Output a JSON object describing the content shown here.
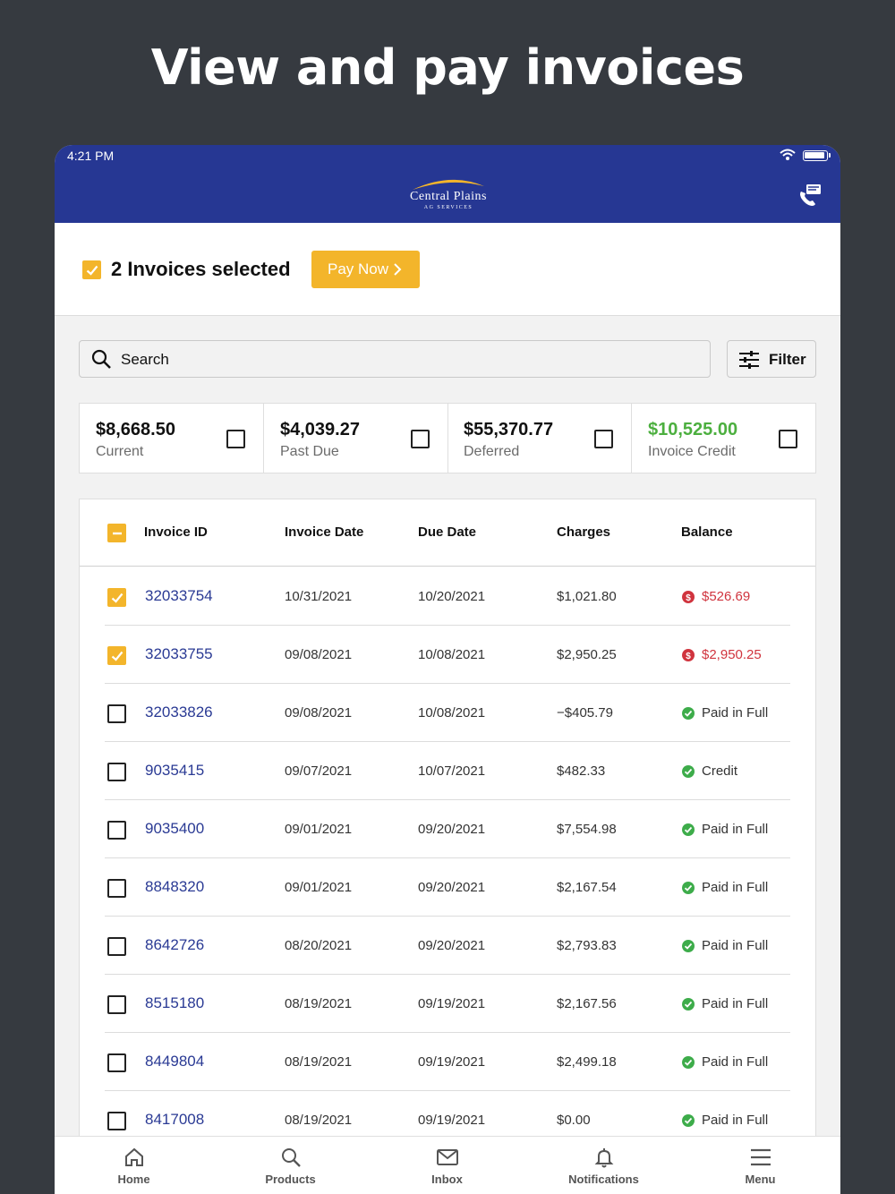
{
  "headline": "View and pay invoices",
  "status": {
    "time": "4:21 PM"
  },
  "brand": {
    "name": "Central Plains",
    "sub": "AG SERVICES"
  },
  "selection": {
    "text": "2 Invoices selected",
    "pay_label": "Pay Now"
  },
  "search": {
    "placeholder": "Search"
  },
  "filter": {
    "label": "Filter"
  },
  "summary": [
    {
      "amount": "$8,668.50",
      "label": "Current"
    },
    {
      "amount": "$4,039.27",
      "label": "Past Due"
    },
    {
      "amount": "$55,370.77",
      "label": "Deferred"
    },
    {
      "amount": "$10,525.00",
      "label": "Invoice Credit"
    }
  ],
  "table": {
    "headers": {
      "id": "Invoice ID",
      "invoice_date": "Invoice Date",
      "due_date": "Due Date",
      "charges": "Charges",
      "balance": "Balance"
    },
    "rows": [
      {
        "id": "32033754",
        "invoice_date": "10/31/2021",
        "due_date": "10/20/2021",
        "charges": "$1,021.80",
        "balance": "$526.69",
        "status": "due",
        "checked": true
      },
      {
        "id": "32033755",
        "invoice_date": "09/08/2021",
        "due_date": "10/08/2021",
        "charges": "$2,950.25",
        "balance": "$2,950.25",
        "status": "due",
        "checked": true
      },
      {
        "id": "32033826",
        "invoice_date": "09/08/2021",
        "due_date": "10/08/2021",
        "charges": "−$405.79",
        "balance": "Paid in Full",
        "status": "paid",
        "checked": false
      },
      {
        "id": "9035415",
        "invoice_date": "09/07/2021",
        "due_date": "10/07/2021",
        "charges": "$482.33",
        "balance": "Credit",
        "status": "paid",
        "checked": false
      },
      {
        "id": "9035400",
        "invoice_date": "09/01/2021",
        "due_date": "09/20/2021",
        "charges": "$7,554.98",
        "balance": "Paid in Full",
        "status": "paid",
        "checked": false
      },
      {
        "id": "8848320",
        "invoice_date": "09/01/2021",
        "due_date": "09/20/2021",
        "charges": "$2,167.54",
        "balance": "Paid in Full",
        "status": "paid",
        "checked": false
      },
      {
        "id": "8642726",
        "invoice_date": "08/20/2021",
        "due_date": "09/20/2021",
        "charges": "$2,793.83",
        "balance": "Paid in Full",
        "status": "paid",
        "checked": false
      },
      {
        "id": "8515180",
        "invoice_date": "08/19/2021",
        "due_date": "09/19/2021",
        "charges": "$2,167.56",
        "balance": "Paid in Full",
        "status": "paid",
        "checked": false
      },
      {
        "id": "8449804",
        "invoice_date": "08/19/2021",
        "due_date": "09/19/2021",
        "charges": "$2,499.18",
        "balance": "Paid in Full",
        "status": "paid",
        "checked": false
      },
      {
        "id": "8417008",
        "invoice_date": "08/19/2021",
        "due_date": "09/19/2021",
        "charges": "$0.00",
        "balance": "Paid in Full",
        "status": "paid",
        "checked": false
      }
    ]
  },
  "tabs": [
    {
      "label": "Home",
      "icon": "home-icon"
    },
    {
      "label": "Products",
      "icon": "search-icon"
    },
    {
      "label": "Inbox",
      "icon": "envelope-icon"
    },
    {
      "label": "Notifications",
      "icon": "bell-icon"
    },
    {
      "label": "Menu",
      "icon": "hamburger-icon"
    }
  ],
  "colors": {
    "header": "#263793",
    "accent": "#f3b52b",
    "credit": "#4caf3f",
    "due": "#d0343e",
    "paid": "#3dac4a",
    "link": "#2a3a94"
  }
}
